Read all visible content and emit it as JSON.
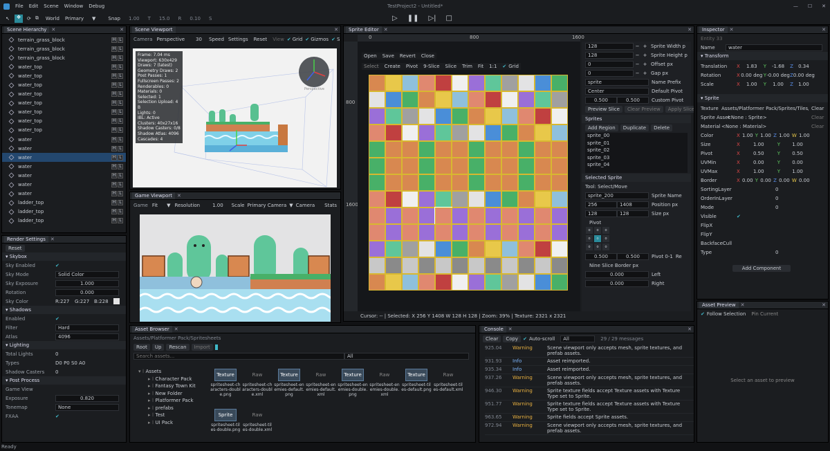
{
  "title": "TestProject2 - Untitled*",
  "menu": [
    "File",
    "Edit",
    "Scene",
    "Window",
    "Debug"
  ],
  "toolbar": {
    "space": "World",
    "pivot": "Primary",
    "snap": "Snap",
    "snap_vals": [
      "1.00",
      "T",
      "15.0",
      "R",
      "0.10",
      "S"
    ]
  },
  "hierarchy": {
    "title": "Scene Hierarchy",
    "items": [
      "terrain_grass_block",
      "terrain_grass_block",
      "terrain_grass_block",
      "water_top",
      "water_top",
      "water_top",
      "water_top",
      "water_top",
      "water_top",
      "water_top",
      "water_top",
      "water",
      "water",
      "water",
      "water",
      "water",
      "water",
      "water",
      "ladder_top",
      "ladder_top",
      "ladder_top"
    ],
    "selected_index": 13
  },
  "render": {
    "title": "Render Settings",
    "reset": "Reset",
    "skybox": "Skybox",
    "sky_enabled": "Sky Enabled",
    "sky_mode": "Sky Mode",
    "sky_mode_val": "Solid Color",
    "sky_exposure": "Sky Exposure",
    "sky_exposure_val": "1.000",
    "rotation": "Rotation",
    "rotation_val": "0.000",
    "sky_color": "Sky Color",
    "sky_color_vals": [
      "R:227",
      "G:227",
      "B:228"
    ],
    "shadows": "Shadows",
    "enabled": "Enabled",
    "filter": "Filter",
    "filter_val": "Hard",
    "atlas": "Atlas",
    "atlas_val": "4096",
    "lighting": "Lighting",
    "total_lights": "Total Lights",
    "total_lights_val": "0",
    "types": "Types",
    "types_val": "D0 P0 S0 A0",
    "shadow_casters": "Shadow Casters",
    "shadow_casters_val": "0",
    "post": "Post Process",
    "game_view": "Game View",
    "exposure": "Exposure",
    "exposure_val": "0.820",
    "tonemap": "Tonemap",
    "tonemap_val": "None",
    "fxaa": "FXAA"
  },
  "scene": {
    "title": "Scene Viewport",
    "camera": "Camera",
    "persp": "Perspective",
    "fov": "30",
    "speed": "Speed",
    "settings": "Settings",
    "reset": "Reset",
    "view": "View",
    "grid": "Grid",
    "gizmos": "Gizmos",
    "s": "S",
    "stats": [
      "Frame: 7.04 ms",
      "Viewport: 630x429",
      "Draws: 7 (latest)",
      "Geometry Draws: 2",
      "Post Passes: 1",
      "Fullscreen Passes: 2",
      "Renderables: 0",
      "Materials: 0",
      "Selected: 1",
      "Selection Upload: 4 B",
      "Lights: 0",
      "IBL: Active",
      "Clusters: 40x27x16",
      "Shadow Casters: 0/8",
      "Shadow Atlas: 4096",
      "Cascades: 4"
    ],
    "gizmo_label": "Perspective"
  },
  "game": {
    "title": "Game Viewport",
    "game": "Game",
    "fit": "Fit",
    "resolution": "Resolution",
    "scale_val": "1.00",
    "scale": "Scale",
    "camera_sel": "Primary Camera",
    "camera": "Camera",
    "stats": "Stats"
  },
  "sprite": {
    "title": "Sprite Editor",
    "ruler": [
      "0",
      "800",
      "1600"
    ],
    "vruler": [
      "800",
      "1600"
    ],
    "buttons": [
      "Open",
      "Save",
      "Revert",
      "Close"
    ],
    "tools": [
      "Select",
      "Create",
      "Pivot",
      "9-Slice",
      "Slice",
      "Trim",
      "Fit",
      "1:1",
      "Grid"
    ],
    "status": "Cursor: -- | Selected: X 256  Y 1408  W 128  H 128 | Zoom: 39% | Texture: 2321 x 2321",
    "props": [
      {
        "v": "128",
        "l": "Sprite Width p"
      },
      {
        "v": "128",
        "l": "Sprite Height p"
      },
      {
        "v": "0",
        "l": "Offset px"
      },
      {
        "v": "0",
        "l": "Gap px"
      }
    ],
    "name_prefix_val": "sprite",
    "name_prefix": "Name Prefix",
    "pivot_val": "Center",
    "default_pivot": "Default Pivot",
    "custom_pivot_vals": [
      "0.500",
      "0.500"
    ],
    "custom_pivot": "Custom Pivot",
    "preview_slice": "Preview Slice",
    "clear_preview": "Clear Preview",
    "apply_slice": "Apply Slice",
    "sprites_hdr": "Sprites",
    "add_region": "Add Region",
    "duplicate": "Duplicate",
    "delete": "Delete",
    "sprite_list": [
      "sprite_00",
      "sprite_01",
      "sprite_02",
      "sprite_03",
      "sprite_04"
    ],
    "selected_hdr": "Selected Sprite",
    "tool": "Tool: Select/Move",
    "sprite_name_val": "sprite_200",
    "sprite_name": "Sprite Name",
    "pos_vals": [
      "256",
      "1408"
    ],
    "pos": "Position px",
    "size_vals": [
      "128",
      "128"
    ],
    "size": "Size px",
    "pivot_hdr": "Pivot",
    "pivot01_vals": [
      "0.500",
      "0.500"
    ],
    "pivot01": "Pivot 0-1",
    "re": "Re",
    "nine": "Nine Slice Border px",
    "left_val": "0.000",
    "left": "Left",
    "right_val": "0.000",
    "right": "Right"
  },
  "inspector": {
    "title": "Inspector",
    "entity": "Entity 33",
    "name_lbl": "Name",
    "name_val": "water",
    "transform": "Transform",
    "translation": "Translation",
    "t_vals": [
      "1.83",
      "-1.68",
      "0.34"
    ],
    "rotation": "Rotation",
    "r_vals": [
      "0.00 deg",
      "-0.00 deg",
      "0.00 deg"
    ],
    "scale": "Scale",
    "s_vals": [
      "1.00",
      "1.00",
      "1.00"
    ],
    "sprite": "Sprite",
    "texture": "Texture",
    "texture_val": "Assets/Platformer Pack/Sprites/Tiles/D",
    "clear": "Clear",
    "sprite_asset": "Sprite Asset",
    "sprite_asset_val": "<None : Sprite>",
    "material": "Material",
    "material_val": "<None : Material>",
    "color": "Color",
    "color_vals": [
      "1.00",
      "1.00",
      "1.00",
      "1.00"
    ],
    "size": "Size",
    "size_vals": [
      "1.00",
      "1.00"
    ],
    "pivot": "Pivot",
    "pivot_vals": [
      "0.50",
      "0.50"
    ],
    "uvmin": "UVMin",
    "uvmin_vals": [
      "0.00",
      "0.00"
    ],
    "uvmax": "UVMax",
    "uvmax_vals": [
      "1.00",
      "1.00"
    ],
    "border": "Border",
    "border_vals": [
      "0.00",
      "0.00",
      "0.00",
      "0.00"
    ],
    "sorting": "SortingLayer",
    "sorting_val": "0",
    "order": "OrderInLayer",
    "order_val": "0",
    "mode": "Mode",
    "mode_val": "0",
    "visible": "Visible",
    "flipx": "FlipX",
    "flipy": "FlipY",
    "backface": "BackfaceCull",
    "type": "Type",
    "type_val": "0",
    "add_component": "Add Component"
  },
  "asset_preview": {
    "title": "Asset Preview",
    "follow": "Follow Selection",
    "pin": "Pin Current",
    "empty": "Select an asset to preview"
  },
  "assets": {
    "title": "Asset Browser",
    "path": "Assets/Platformer Pack/Spritesheets",
    "root": "Root",
    "up": "Up",
    "rescan": "Rescan",
    "import": "Import",
    "search": "Search assets...",
    "filter": "All",
    "tree": [
      "Assets",
      "Character Pack",
      "Fantasy Town Kit",
      "New Folder",
      "Platformer Pack",
      "prefabs",
      "Test",
      "UI Pack"
    ],
    "files": [
      {
        "tag": "Texture",
        "name": "spritesheet-characters-double.png"
      },
      {
        "tag": "Raw",
        "name": "spritesheet-characters-double.xml"
      },
      {
        "tag": "Texture",
        "name": "spritesheet-enemies-default.png"
      },
      {
        "tag": "Raw",
        "name": "spritesheet-enemies-default.xml"
      },
      {
        "tag": "Texture",
        "name": "spritesheet-enemies-double.png"
      },
      {
        "tag": "Raw",
        "name": "spritesheet-enemies-double.xml"
      },
      {
        "tag": "Texture",
        "name": "spritesheet-tiles-default.png"
      },
      {
        "tag": "Raw",
        "name": "spritesheet-tiles-default.xml"
      },
      {
        "tag": "Sprite",
        "name": "spritesheet-tiles-double.png"
      },
      {
        "tag": "Raw",
        "name": "spritesheet-tiles-double.xml"
      }
    ]
  },
  "console": {
    "title": "Console",
    "clear": "Clear",
    "copy": "Copy",
    "autoscroll": "Auto-scroll",
    "filter": "All",
    "count": "29 / 29 messages",
    "logs": [
      {
        "t": "925.04",
        "lvl": "Warning",
        "msg": "Scene viewport only accepts mesh, sprite textures, and prefab assets."
      },
      {
        "t": "931.93",
        "lvl": "Info",
        "msg": "Asset reimported."
      },
      {
        "t": "935.34",
        "lvl": "Info",
        "msg": "Asset reimported."
      },
      {
        "t": "937.26",
        "lvl": "Warning",
        "msg": "Scene viewport only accepts mesh, sprite textures, and prefab assets."
      },
      {
        "t": "946.30",
        "lvl": "Warning",
        "msg": "Sprite texture fields accept Texture assets with Texture Type set to Sprite."
      },
      {
        "t": "951.77",
        "lvl": "Warning",
        "msg": "Sprite texture fields accept Texture assets with Texture Type set to Sprite."
      },
      {
        "t": "963.65",
        "lvl": "Warning",
        "msg": "Sprite fields accept Sprite assets."
      },
      {
        "t": "972.94",
        "lvl": "Warning",
        "msg": "Scene viewport only accepts mesh, sprite textures, and prefab assets."
      }
    ]
  },
  "status": "Ready"
}
